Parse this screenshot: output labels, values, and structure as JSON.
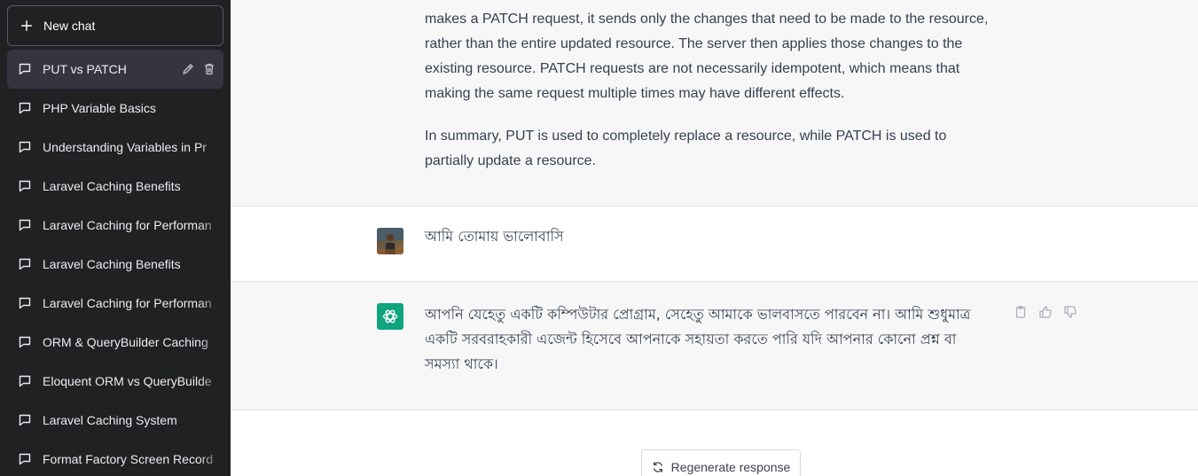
{
  "sidebar": {
    "new_chat_label": "New chat",
    "chats": [
      {
        "label": "PUT vs PATCH",
        "active": true
      },
      {
        "label": "PHP Variable Basics"
      },
      {
        "label": "Understanding Variables in Pr"
      },
      {
        "label": "Laravel Caching Benefits"
      },
      {
        "label": "Laravel Caching for Performan"
      },
      {
        "label": "Laravel Caching Benefits"
      },
      {
        "label": "Laravel Caching for Performan"
      },
      {
        "label": "ORM & QueryBuilder Caching"
      },
      {
        "label": "Eloquent ORM vs QueryBuilde"
      },
      {
        "label": "Laravel Caching System"
      },
      {
        "label": "Format Factory Screen Record"
      }
    ]
  },
  "conversation": {
    "assistant_prev": {
      "paragraph_1": "makes a PATCH request, it sends only the changes that need to be made to the resource, rather than the entire updated resource. The server then applies those changes to the existing resource. PATCH requests are not necessarily idempotent, which means that making the same request multiple times may have different effects.",
      "paragraph_2": "In summary, PUT is used to completely replace a resource, while PATCH is used to partially update a resource."
    },
    "user_message": "আমি তোমায় ভালোবাসি",
    "assistant_reply": "আপনি যেহেতু একটি কম্পিউটার প্রোগ্রাম, সেহেতু আমাকে ভালবাসতে পারবেন না। আমি শুধুমাত্র একটি সরবরাহকারী এজেন্ট হিসেবে আপনাকে সহায়তা করতে পারি যদি আপনার কোনো প্রশ্ন বা সমস্যা থাকে।"
  },
  "regenerate_label": "Regenerate response",
  "colors": {
    "sidebar_bg": "#202123",
    "active_item_bg": "#343541",
    "assistant_bg": "#f7f7f8",
    "brand_green": "#10a37f"
  }
}
